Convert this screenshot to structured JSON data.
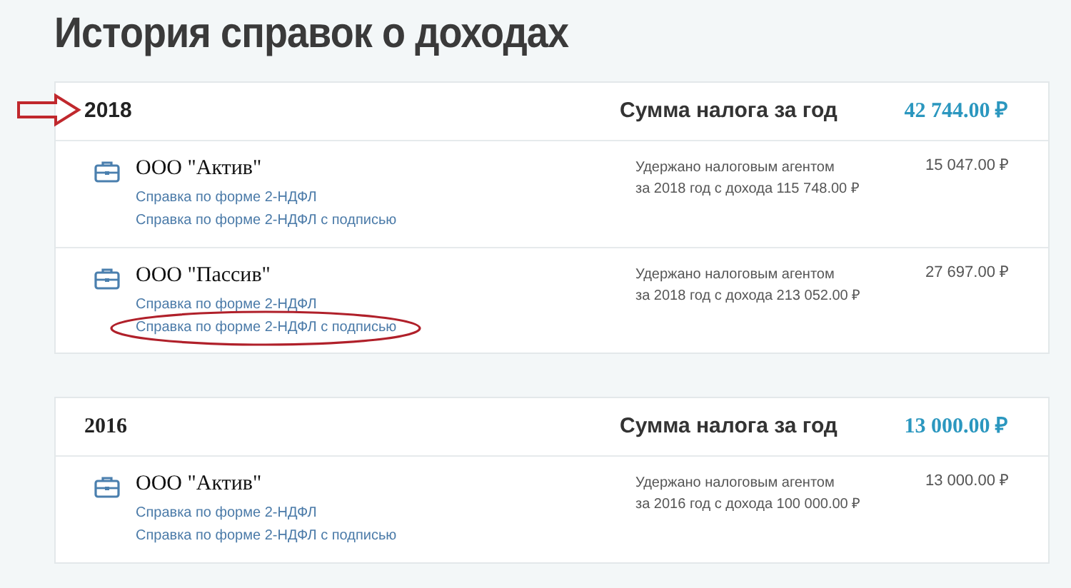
{
  "title": "История справок о доходах",
  "years": [
    {
      "year": "2018",
      "arrow_marker": true,
      "total_label": "Сумма налога за год",
      "total": "42 744.00 ₽",
      "rows": [
        {
          "company": "ООО \"Актив\"",
          "links": [
            {
              "label": "Справка по форме 2-НДФЛ",
              "circled": false
            },
            {
              "label": "Справка по форме 2-НДФЛ с подписью",
              "circled": false
            }
          ],
          "withheld_line1": "Удержано налоговым агентом",
          "withheld_line2": "за 2018 год с дохода 115 748.00 ₽",
          "amount": "15 047.00 ₽"
        },
        {
          "company": "ООО \"Пассив\"",
          "links": [
            {
              "label": "Справка по форме 2-НДФЛ",
              "circled": false
            },
            {
              "label": "Справка по форме 2-НДФЛ с подписью",
              "circled": true
            }
          ],
          "withheld_line1": "Удержано налоговым агентом",
          "withheld_line2": "за 2018 год с дохода 213 052.00 ₽",
          "amount": "27 697.00 ₽"
        }
      ]
    },
    {
      "year": "2016",
      "arrow_marker": false,
      "total_label": "Сумма налога за год",
      "total": "13 000.00 ₽",
      "rows": [
        {
          "company": "ООО \"Актив\"",
          "links": [
            {
              "label": "Справка по форме 2-НДФЛ",
              "circled": false
            },
            {
              "label": "Справка по форме 2-НДФЛ с подписью",
              "circled": false
            }
          ],
          "withheld_line1": "Удержано налоговым агентом",
          "withheld_line2": "за 2016  год с дохода 100 000.00 ₽",
          "amount": "13 000.00 ₽"
        }
      ]
    }
  ]
}
